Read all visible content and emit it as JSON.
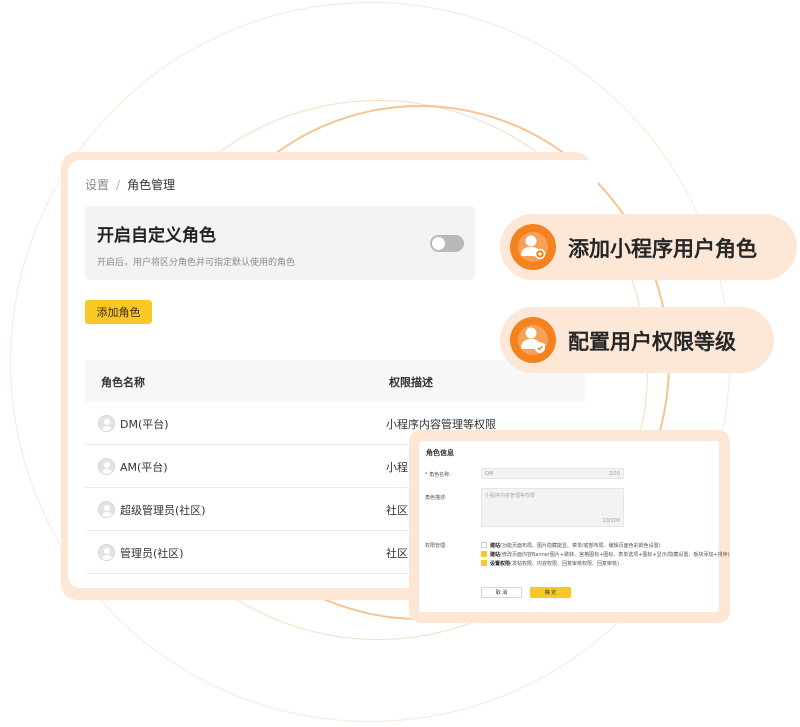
{
  "breadcrumb": {
    "root": "设置",
    "separator": "/",
    "current": "角色管理"
  },
  "custom_role": {
    "title": "开启自定义角色",
    "description": "开启后，用户将区分角色并可指定默认使用的角色",
    "enabled": false
  },
  "add_role_button": "添加角色",
  "table": {
    "headers": {
      "name": "角色名称",
      "description": "权限描述"
    },
    "rows": [
      {
        "name": "DM(平台)",
        "description": "小程序内容管理等权限"
      },
      {
        "name": "AM(平台)",
        "description": "小程..."
      },
      {
        "name": "超级管理员(社区)",
        "description": "社区..."
      },
      {
        "name": "管理员(社区)",
        "description": "社区..."
      }
    ]
  },
  "callouts": [
    {
      "text": "添加小程序用户角色",
      "icon": "user-add-icon"
    },
    {
      "text": "配置用户权限等级",
      "icon": "user-shield-icon"
    }
  ],
  "dialog": {
    "title": "角色信息",
    "name_label": "* 角色名称:",
    "name_value": "DM",
    "name_count": "2/20",
    "desc_label": "角色描述:",
    "desc_placeholder": "小程序内容管理等权限",
    "desc_count": "10/100",
    "perm_label": "权限管理:",
    "permissions": [
      {
        "title": "建站",
        "detail": "(功能页面布局、图片隐藏能显、菜单/底部布局、编辑页面色彩颜色设置)",
        "checked": false
      },
      {
        "title": "建站",
        "detail": "(修改页面内容Banner图片+跳转、宫格图标+图标、表单选项+图标+显示/隐藏设置、板块添加+排序)",
        "checked": true
      },
      {
        "title": "设置权限",
        "detail": "(发帖权限、内容权限、回复审核权限、回复审核)",
        "checked": true
      }
    ],
    "cancel_label": "取 消",
    "ok_label": "确 定"
  },
  "colors": {
    "accent": "#f9c825",
    "orange": "#f3821f",
    "peach": "#fde6d4"
  }
}
